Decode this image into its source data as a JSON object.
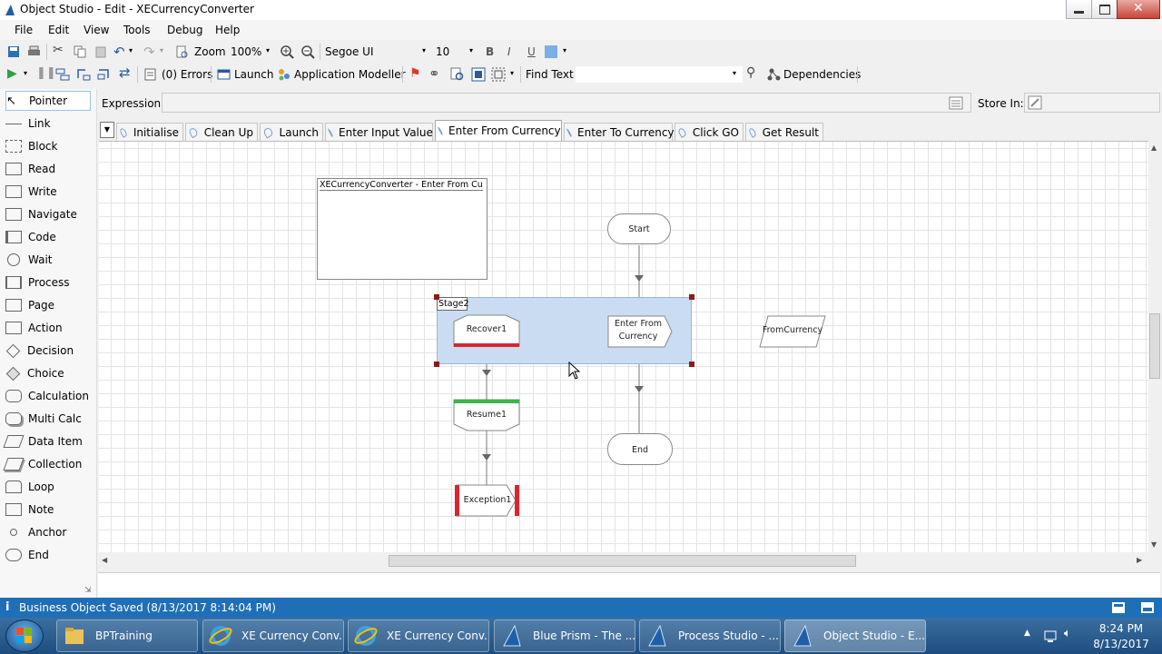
{
  "window": {
    "title": "Object Studio  - Edit - XECurrencyConverter"
  },
  "menu": [
    "File",
    "Edit",
    "View",
    "Tools",
    "Debug",
    "Help"
  ],
  "toolbar1": {
    "zoom_label": "Zoom",
    "zoom_value": "100%",
    "font_name": "Segoe UI",
    "font_size": "10",
    "bold": "B",
    "italic": "I",
    "underline": "U"
  },
  "toolbar2": {
    "errors": "(0) Errors",
    "launch": "Launch",
    "app_modeller": "Application Modeller",
    "find_text": "Find Text",
    "dependencies": "Dependencies"
  },
  "palette": [
    {
      "label": "Pointer",
      "icon": "pointer-icon"
    },
    {
      "label": "Link",
      "icon": "link-icon"
    },
    {
      "label": "Block",
      "icon": "block-icon"
    },
    {
      "label": "Read",
      "icon": "read-icon"
    },
    {
      "label": "Write",
      "icon": "write-icon"
    },
    {
      "label": "Navigate",
      "icon": "navigate-icon"
    },
    {
      "label": "Code",
      "icon": "code-icon"
    },
    {
      "label": "Wait",
      "icon": "wait-icon"
    },
    {
      "label": "Process",
      "icon": "process-icon"
    },
    {
      "label": "Page",
      "icon": "page-icon"
    },
    {
      "label": "Action",
      "icon": "action-icon"
    },
    {
      "label": "Decision",
      "icon": "decision-icon"
    },
    {
      "label": "Choice",
      "icon": "choice-icon"
    },
    {
      "label": "Calculation",
      "icon": "calculation-icon"
    },
    {
      "label": "Multi Calc",
      "icon": "multi-calc-icon"
    },
    {
      "label": "Data Item",
      "icon": "data-item-icon"
    },
    {
      "label": "Collection",
      "icon": "collection-icon"
    },
    {
      "label": "Loop",
      "icon": "loop-icon"
    },
    {
      "label": "Note",
      "icon": "note-icon"
    },
    {
      "label": "Anchor",
      "icon": "anchor-icon"
    },
    {
      "label": "End",
      "icon": "end-icon"
    }
  ],
  "expression": {
    "label": "Expression:",
    "value": "",
    "store_label": "Store In:"
  },
  "tabs": [
    "Initialise",
    "Clean Up",
    "Launch",
    "Enter Input Value",
    "Enter From Currency",
    "Enter To Currency",
    "Click GO",
    "Get Result"
  ],
  "active_tab": "Enter From Currency",
  "diagram": {
    "info_box": "XECurrencyConverter - Enter From Curr",
    "block_label": "Stage2",
    "start": "Start",
    "recover": "Recover1",
    "action": "Enter From Currency",
    "data_item": "FromCurrency",
    "resume": "Resume1",
    "end": "End",
    "exception": "Exception1"
  },
  "status": {
    "text": "Business Object Saved (8/13/2017 8:14:04 PM)"
  },
  "taskbar": {
    "items": [
      "BPTraining",
      "XE Currency Conv...",
      "XE Currency Conv...",
      "Blue Prism - The ...",
      "Process Studio  - ...",
      "Object Studio  - E..."
    ],
    "time": "8:24 PM",
    "date": "8/13/2017"
  },
  "colors": {
    "accent": "#1f6fb8",
    "block_fill": "#c9dcf2",
    "recover_bar": "#d9262e",
    "resume_bar": "#3cb54a",
    "exception_bar": "#d9262e"
  }
}
